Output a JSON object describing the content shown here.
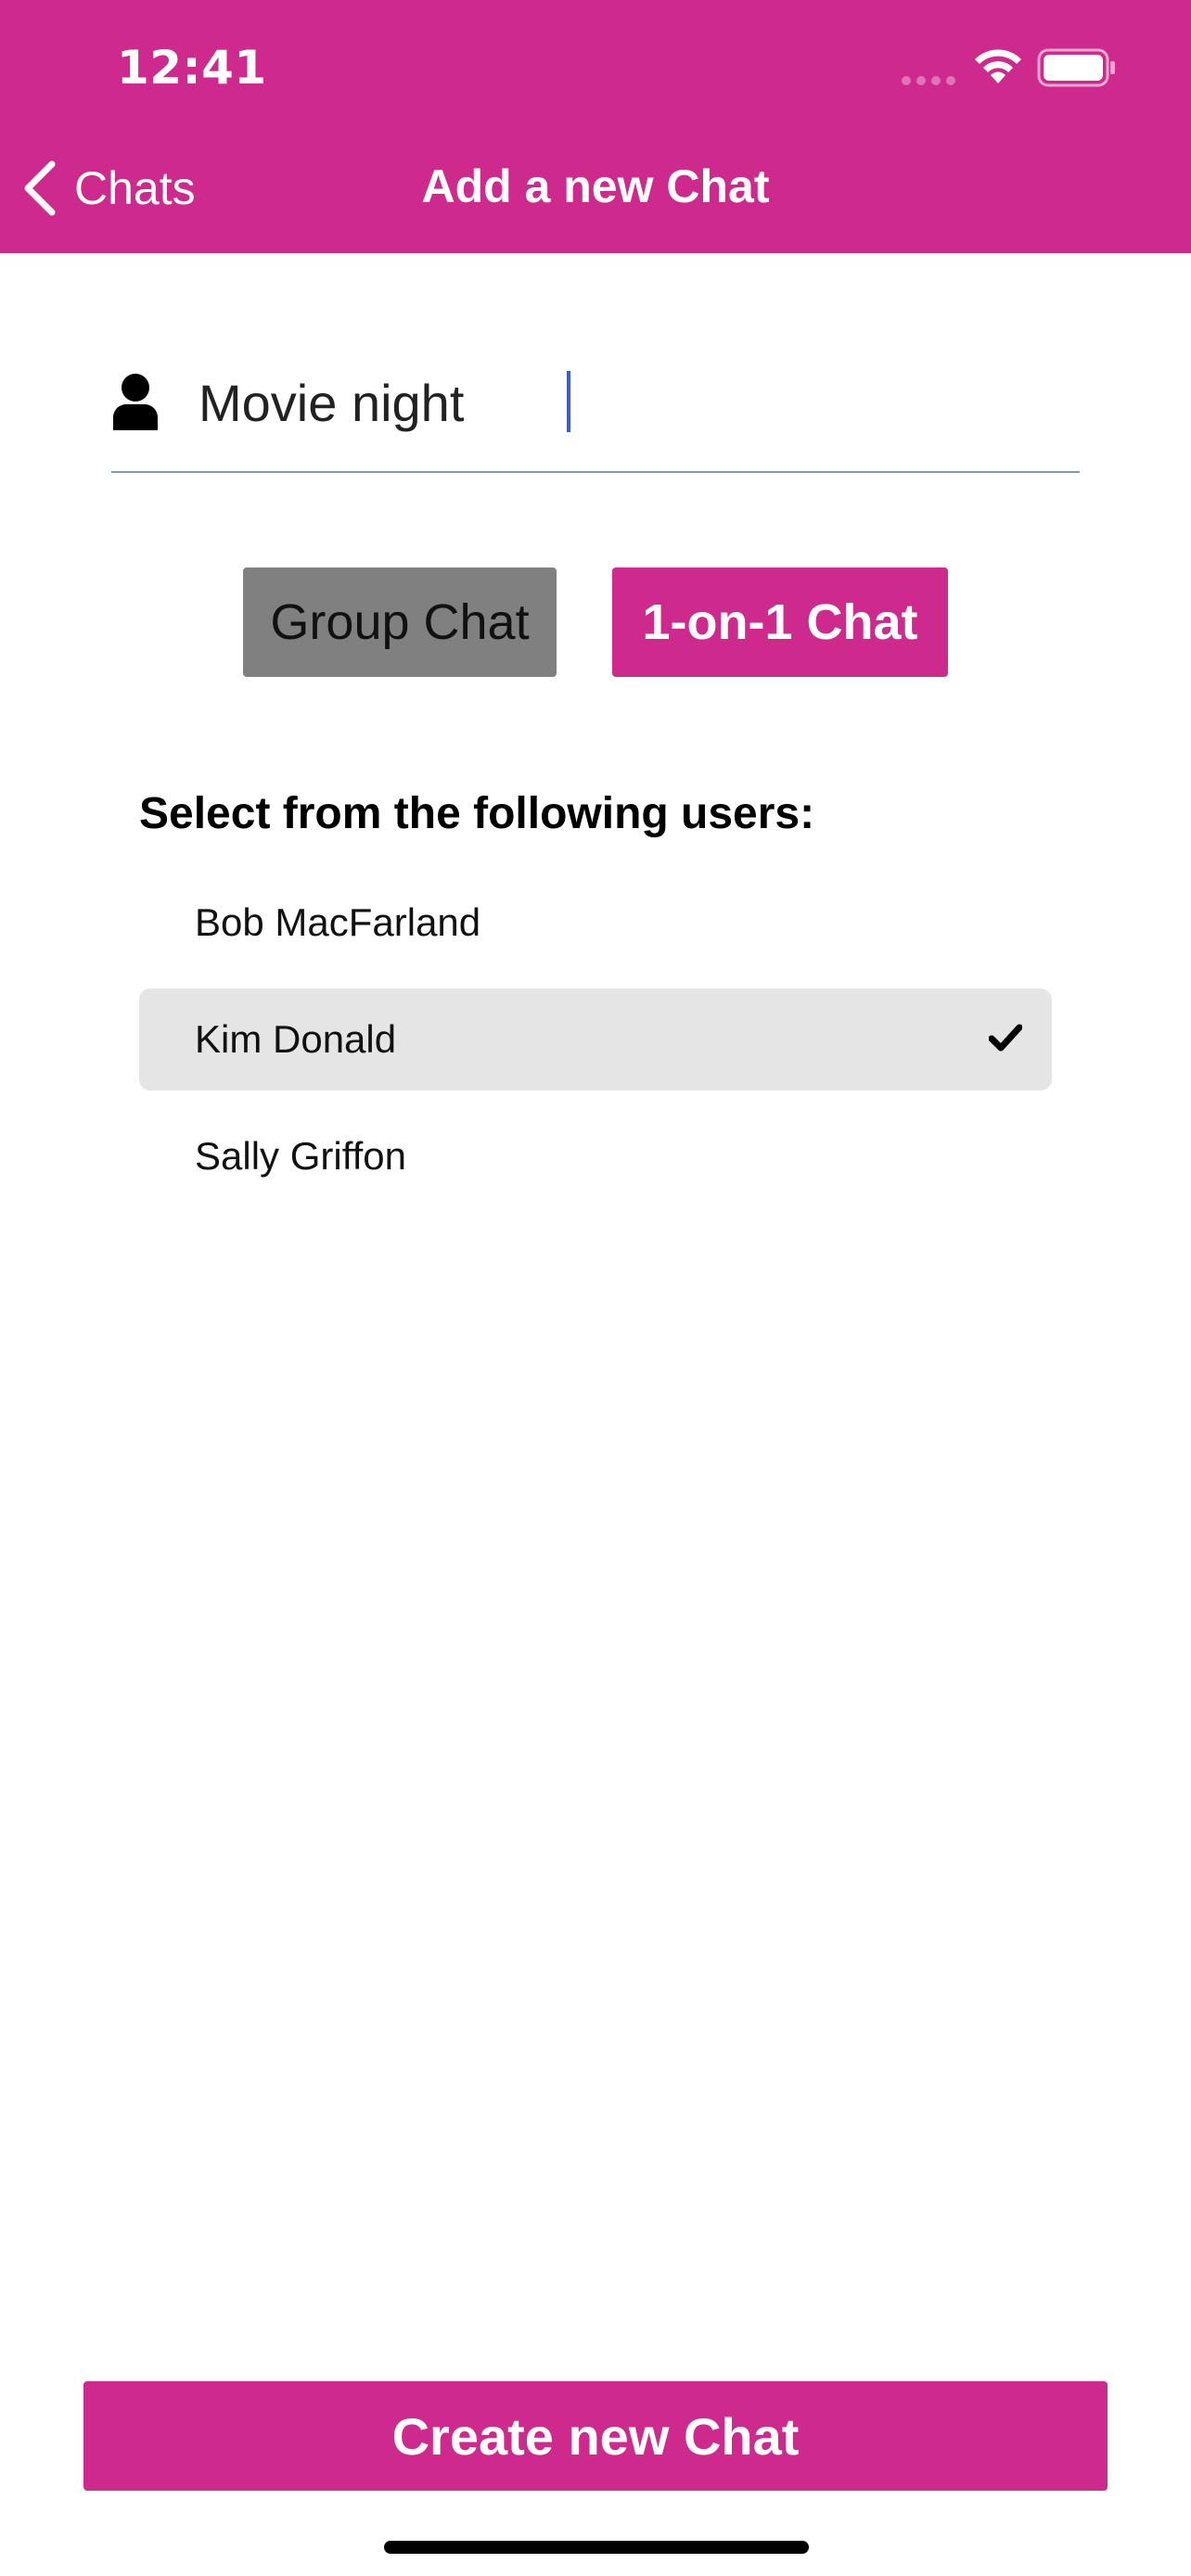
{
  "status_bar": {
    "time": "12:41"
  },
  "nav": {
    "back_label": "Chats",
    "title": "Add a new Chat"
  },
  "chat_name": {
    "value": "Movie night"
  },
  "chat_type": {
    "group_label": "Group Chat",
    "one_on_one_label": "1-on-1 Chat",
    "selected": "1-on-1 Chat"
  },
  "users_section": {
    "heading": "Select from the following users:",
    "users": [
      {
        "name": "Bob MacFarland",
        "selected": false
      },
      {
        "name": "Kim Donald",
        "selected": true
      },
      {
        "name": "Sally Griffon",
        "selected": false
      }
    ]
  },
  "actions": {
    "create_label": "Create new Chat"
  },
  "colors": {
    "accent": "#CE2A8D",
    "unselected_button": "#808080",
    "selected_row": "#E5E5E5",
    "caret": "#3B5BDB"
  },
  "icons": {
    "back": "chevron-left-icon",
    "person": "person-icon",
    "check": "checkmark-icon",
    "wifi": "wifi-icon",
    "battery": "battery-icon"
  }
}
